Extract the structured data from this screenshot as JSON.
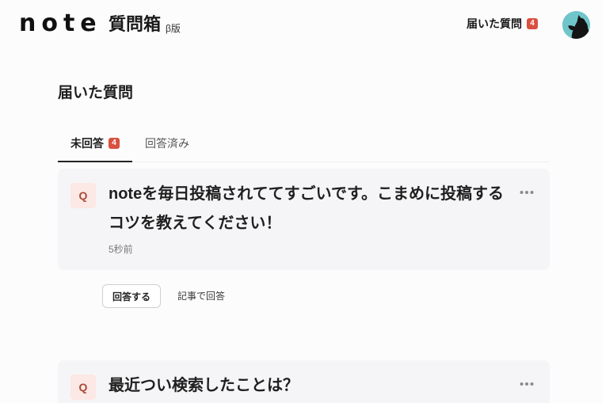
{
  "header": {
    "logo": "note",
    "service_title": "質問箱",
    "beta_label": "β版",
    "inbox_link": "届いた質問",
    "inbox_count": "4",
    "avatar_icon": "dog-avatar-icon"
  },
  "page": {
    "title": "届いた質問"
  },
  "tabs": [
    {
      "label": "未回答",
      "badge": "4",
      "active": true
    },
    {
      "label": "回答済み",
      "active": false
    }
  ],
  "questions": [
    {
      "badge": "Q",
      "text": "noteを毎日投稿されててすごいです。こまめに投稿するコツを教えてください！",
      "time": "5秒前",
      "more_icon": "more-horizontal-icon"
    },
    {
      "badge": "Q",
      "text": "最近つい検索したことは？",
      "more_icon": "more-horizontal-icon"
    }
  ],
  "actions": {
    "answer_button": "回答する",
    "answer_with_article": "記事で回答"
  },
  "colors": {
    "count_badge": "#d9503f",
    "q_badge_bg": "#fce8e4",
    "q_badge_text": "#a84a3a",
    "card_bg": "#f5f5f7",
    "avatar_bg": "#6fc5c9",
    "active_tab_underline": "#222222"
  }
}
